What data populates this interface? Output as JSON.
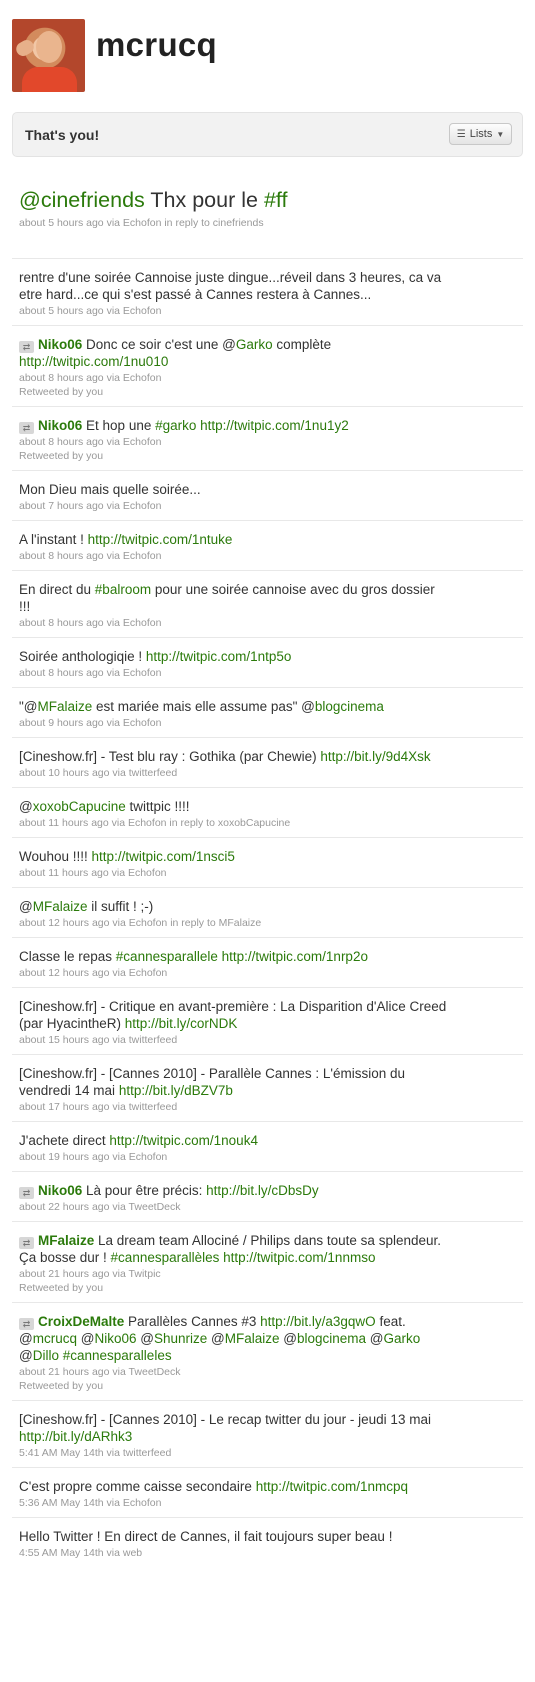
{
  "profile": {
    "screen_name": "mcrucq"
  },
  "bar": {
    "label": "That's you!",
    "lists_button": "Lists"
  },
  "featured": {
    "segments": [
      {
        "t": "@cinefriends",
        "link": true
      },
      {
        "t": " Thx pour le "
      },
      {
        "t": "#ff",
        "link": true
      }
    ],
    "meta": "about 5 hours ago via Echofon in reply to cinefriends"
  },
  "tweets": [
    {
      "segments": [
        {
          "t": "rentre d'une soirée Cannoise juste dingue...réveil dans 3 heures, ca va etre hard...ce qui s'est passé à Cannes restera à Cannes..."
        }
      ],
      "meta": "about 5 hours ago via Echofon"
    },
    {
      "rt": true,
      "author": "Niko06",
      "segments": [
        {
          "t": " Donc ce soir c'est une @"
        },
        {
          "t": "Garko",
          "link": true
        },
        {
          "t": " complète "
        },
        {
          "t": "http://twitpic.com/1nu010",
          "link": true
        }
      ],
      "meta": "about 8 hours ago via Echofon",
      "rt_note": "Retweeted by you"
    },
    {
      "rt": true,
      "author": "Niko06",
      "segments": [
        {
          "t": " Et hop une "
        },
        {
          "t": "#garko",
          "link": true
        },
        {
          "t": " "
        },
        {
          "t": "http://twitpic.com/1nu1y2",
          "link": true
        }
      ],
      "meta": "about 8 hours ago via Echofon",
      "rt_note": "Retweeted by you"
    },
    {
      "segments": [
        {
          "t": "Mon Dieu mais quelle soirée..."
        }
      ],
      "meta": "about 7 hours ago via Echofon"
    },
    {
      "segments": [
        {
          "t": "A l'instant ! "
        },
        {
          "t": "http://twitpic.com/1ntuke",
          "link": true
        }
      ],
      "meta": "about 8 hours ago via Echofon"
    },
    {
      "segments": [
        {
          "t": "En direct du "
        },
        {
          "t": "#balroom",
          "link": true
        },
        {
          "t": " pour une soirée cannoise avec du gros dossier !!!"
        }
      ],
      "meta": "about 8 hours ago via Echofon"
    },
    {
      "segments": [
        {
          "t": "Soirée anthologiqie ! "
        },
        {
          "t": "http://twitpic.com/1ntp5o",
          "link": true
        }
      ],
      "meta": "about 8 hours ago via Echofon"
    },
    {
      "segments": [
        {
          "t": "\"@"
        },
        {
          "t": "MFalaize",
          "link": true
        },
        {
          "t": " est mariée mais elle assume pas\" @"
        },
        {
          "t": "blogcinema",
          "link": true
        }
      ],
      "meta": "about 9 hours ago via Echofon"
    },
    {
      "segments": [
        {
          "t": "[Cineshow.fr] - Test blu ray : Gothika (par Chewie) "
        },
        {
          "t": "http://bit.ly/9d4Xsk",
          "link": true
        }
      ],
      "meta": "about 10 hours ago via twitterfeed"
    },
    {
      "segments": [
        {
          "t": "@"
        },
        {
          "t": "xoxobCapucine",
          "link": true
        },
        {
          "t": " twittpic !!!!"
        }
      ],
      "meta": "about 11 hours ago via Echofon in reply to xoxobCapucine"
    },
    {
      "segments": [
        {
          "t": "Wouhou !!!! "
        },
        {
          "t": "http://twitpic.com/1nsci5",
          "link": true
        }
      ],
      "meta": "about 11 hours ago via Echofon"
    },
    {
      "segments": [
        {
          "t": "@"
        },
        {
          "t": "MFalaize",
          "link": true
        },
        {
          "t": " il suffit ! ;-)"
        }
      ],
      "meta": "about 12 hours ago via Echofon in reply to MFalaize"
    },
    {
      "segments": [
        {
          "t": "Classe le repas "
        },
        {
          "t": "#cannesparallele",
          "link": true
        },
        {
          "t": " "
        },
        {
          "t": "http://twitpic.com/1nrp2o",
          "link": true
        }
      ],
      "meta": "about 12 hours ago via Echofon"
    },
    {
      "segments": [
        {
          "t": "[Cineshow.fr] - Critique en avant-première : La Disparition d'Alice Creed (par HyacintheR) "
        },
        {
          "t": "http://bit.ly/corNDK",
          "link": true
        }
      ],
      "meta": "about 15 hours ago via twitterfeed"
    },
    {
      "segments": [
        {
          "t": "[Cineshow.fr] - [Cannes 2010] - Parallèle Cannes : L'émission du vendredi 14 mai "
        },
        {
          "t": "http://bit.ly/dBZV7b",
          "link": true
        }
      ],
      "meta": "about 17 hours ago via twitterfeed"
    },
    {
      "segments": [
        {
          "t": "J'achete direct "
        },
        {
          "t": "http://twitpic.com/1nouk4",
          "link": true
        }
      ],
      "meta": "about 19 hours ago via Echofon"
    },
    {
      "rt": true,
      "author": "Niko06",
      "segments": [
        {
          "t": " Là pour être précis: "
        },
        {
          "t": "http://bit.ly/cDbsDy",
          "link": true
        }
      ],
      "meta": "about 22 hours ago via TweetDeck"
    },
    {
      "rt": true,
      "author": "MFalaize",
      "segments": [
        {
          "t": " La dream team Allociné / Philips dans toute sa splendeur. Ça bosse dur ! "
        },
        {
          "t": "#cannesparallèles",
          "link": true
        },
        {
          "t": " "
        },
        {
          "t": "http://twitpic.com/1nnmso",
          "link": true
        }
      ],
      "meta": "about 21 hours ago via Twitpic",
      "rt_note": "Retweeted by you"
    },
    {
      "rt": true,
      "author": "CroixDeMalte",
      "segments": [
        {
          "t": " Parallèles Cannes #3 "
        },
        {
          "t": "http://bit.ly/a3gqwO",
          "link": true
        },
        {
          "t": " feat. @"
        },
        {
          "t": "mcrucq",
          "link": true
        },
        {
          "t": " @"
        },
        {
          "t": "Niko06",
          "link": true
        },
        {
          "t": " @"
        },
        {
          "t": "Shunrize",
          "link": true
        },
        {
          "t": " @"
        },
        {
          "t": "MFalaize",
          "link": true
        },
        {
          "t": " @"
        },
        {
          "t": "blogcinema",
          "link": true
        },
        {
          "t": " @"
        },
        {
          "t": "Garko",
          "link": true
        },
        {
          "t": " @"
        },
        {
          "t": "Dillo",
          "link": true
        },
        {
          "t": " "
        },
        {
          "t": "#cannesparalleles",
          "link": true
        }
      ],
      "meta": "about 21 hours ago via TweetDeck",
      "rt_note": "Retweeted by you"
    },
    {
      "segments": [
        {
          "t": "[Cineshow.fr] - [Cannes 2010] - Le recap twitter du jour - jeudi 13 mai "
        },
        {
          "t": "http://bit.ly/dARhk3",
          "link": true
        }
      ],
      "meta": "5:41 AM May 14th via twitterfeed"
    },
    {
      "segments": [
        {
          "t": "C'est propre comme caisse secondaire "
        },
        {
          "t": "http://twitpic.com/1nmcpq",
          "link": true
        }
      ],
      "meta": "5:36 AM May 14th via Echofon"
    },
    {
      "segments": [
        {
          "t": "Hello Twitter ! En direct de Cannes, il fait toujours super beau !"
        }
      ],
      "meta": "4:55 AM May 14th via web"
    }
  ],
  "colors": {
    "link": "#2b7a0b",
    "meta": "#999999",
    "text": "#333333"
  },
  "icons": {
    "retweet": "retweet-icon",
    "lists": "list-icon",
    "caret": "caret-down-icon"
  }
}
